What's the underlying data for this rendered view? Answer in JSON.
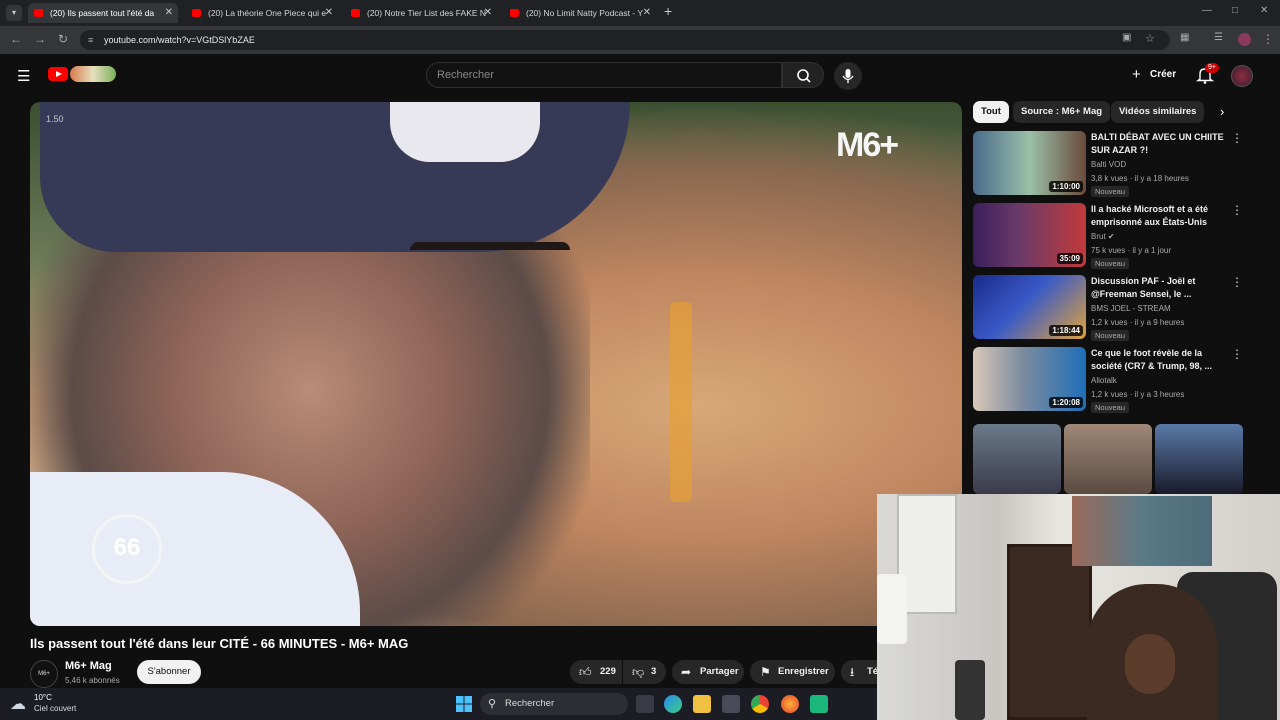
{
  "browser": {
    "tabs": [
      {
        "label": "(20) Ils passent tout l'été da",
        "active": true
      },
      {
        "label": "(20) La théorie One Piece qui e",
        "active": false
      },
      {
        "label": "(20) Notre Tier List des FAKE N",
        "active": false
      },
      {
        "label": "(20) No Limit Natty Podcast - Y",
        "active": false
      }
    ],
    "url": "youtube.com/watch?v=VGtDSlYbZAE"
  },
  "youtube": {
    "search_placeholder": "Rechercher",
    "create_label": "Créer",
    "notif_badge": "9+",
    "video": {
      "speed_label": "1.50",
      "watermark": "M6+",
      "logo66": "66",
      "title": "Ils passent tout l'été dans leur CITÉ - 66 MINUTES - M6+ MAG",
      "channel": "M6+ Mag",
      "channel_avatar_text": "M6+ MAG",
      "subscribers": "5,46 k abonnés",
      "subscribe_label": "S'abonner",
      "likes": "229",
      "dislikes": "3",
      "share_label": "Partager",
      "save_label": "Enregistrer",
      "download_label": "Té"
    },
    "chips": [
      "Tout",
      "Source : M6+ Mag",
      "Vidéos similaires"
    ],
    "recommendations": [
      {
        "title": "BALTI DÉBAT AVEC UN CHIITE SUR AZAR ?!",
        "channel": "Balti VOD",
        "meta": "3,8 k vues · il y a 18 heures",
        "badge": "Nouveau",
        "duration": "1:10:00",
        "colors": [
          "#2f3b4a",
          "#9ac0a8"
        ]
      },
      {
        "title": "Il a hacké Microsoft et a été emprisonné aux États-Unis",
        "channel": "Brut",
        "meta": "75 k vues · il y a 1 jour",
        "badge": "Nouveau",
        "duration": "35:09",
        "colors": [
          "#3a1e5a",
          "#c23a3a"
        ]
      },
      {
        "title": "Discussion PAF - Joël et @Freeman Sensei, le ...",
        "channel": "BMS JOEL - STREAM",
        "meta": "1,2 k vues · il y a 9 heures",
        "badge": "Nouveau",
        "duration": "1:18:44",
        "colors": [
          "#1a2a8a",
          "#e0a23a"
        ]
      },
      {
        "title": "Ce que le foot révèle de la société (CR7 & Trump, 98, ...",
        "channel": "Aliotalk",
        "meta": "1,2 k vues · il y a 3 heures",
        "badge": "Nouveau",
        "duration": "1:20:08",
        "colors": [
          "#1f6fb8",
          "#d8c8b8"
        ]
      }
    ]
  },
  "taskbar": {
    "temp": "10°C",
    "condition": "Ciel couvert",
    "search_label": "Rechercher"
  }
}
